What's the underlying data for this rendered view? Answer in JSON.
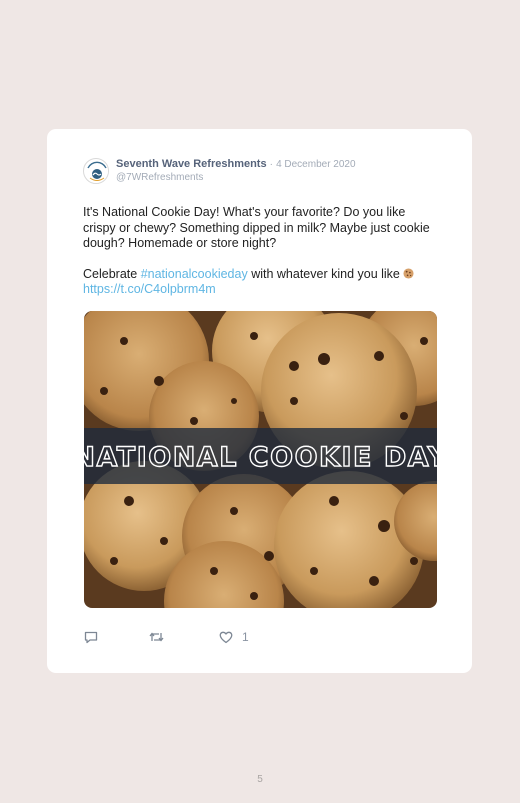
{
  "tweet": {
    "author_name": "Seventh Wave Refreshments",
    "separator": "·",
    "date": "4 December 2020",
    "handle": "@7WRefreshments",
    "paragraph1": "It's National Cookie Day! What's your favorite? Do you like crispy or chewy? Something dipped in milk? Maybe just cookie dough? Homemade or store night?",
    "paragraph2_before": "Celebrate ",
    "hashtag": "#nationalcookieday",
    "paragraph2_after": " with whatever kind you like ",
    "emoji": "cookie-emoji",
    "url": "https://t.co/C4olpbrm4m",
    "image_banner_text": "NATIONAL COOKIE DAY",
    "like_count": "1"
  },
  "icons": {
    "reply": "reply-icon",
    "retweet": "retweet-icon",
    "like": "heart-icon"
  },
  "colors": {
    "background": "#efe7e5",
    "card": "#ffffff",
    "name": "#56637a",
    "link": "#5fb6e3",
    "muted": "#a3abb7"
  },
  "page": {
    "number": "5"
  }
}
